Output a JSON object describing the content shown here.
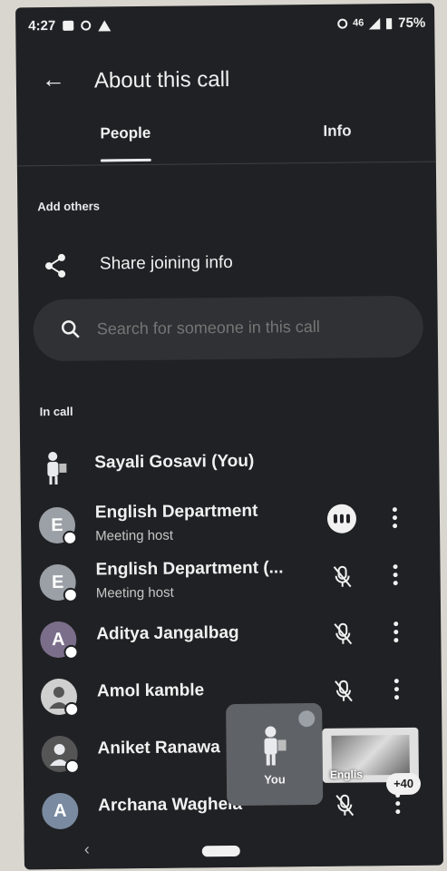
{
  "status_bar": {
    "time": "4:27",
    "network": "46",
    "battery": "75%"
  },
  "header": {
    "title": "About this call"
  },
  "tabs": [
    {
      "label": "People",
      "active": true
    },
    {
      "label": "Info",
      "active": false
    }
  ],
  "add_others": {
    "heading": "Add others",
    "share_label": "Share joining info"
  },
  "search": {
    "placeholder": "Search for someone in this call"
  },
  "in_call": {
    "heading": "In call"
  },
  "participants": [
    {
      "name": "Sayali Gosavi (You)",
      "subtitle": "",
      "initial": "",
      "avatar_color": "#202124",
      "icon": "person-figure-icon"
    },
    {
      "name": "English Department",
      "subtitle": "Meeting host",
      "initial": "E",
      "avatar_color": "#9aa0a6",
      "status": "speaking"
    },
    {
      "name": "English Department (...",
      "subtitle": "Meeting host",
      "initial": "E",
      "avatar_color": "#9aa0a6",
      "status": "muted"
    },
    {
      "name": "Aditya Jangalbag",
      "subtitle": "",
      "initial": "A",
      "avatar_color": "#7b6e8a",
      "status": "muted"
    },
    {
      "name": "Amol kamble",
      "subtitle": "",
      "initial": "",
      "avatar_color": "#cfcfcf",
      "status": "muted"
    },
    {
      "name": "Aniket Ranawa",
      "subtitle": "",
      "initial": "",
      "avatar_color": "#555555",
      "status": "muted"
    },
    {
      "name": "Archana Waghela",
      "subtitle": "",
      "initial": "A",
      "avatar_color": "#7a8aa0",
      "status": "muted"
    }
  ],
  "pip": {
    "you_label": "You",
    "english_label": "Englis",
    "more_count": "+40"
  }
}
